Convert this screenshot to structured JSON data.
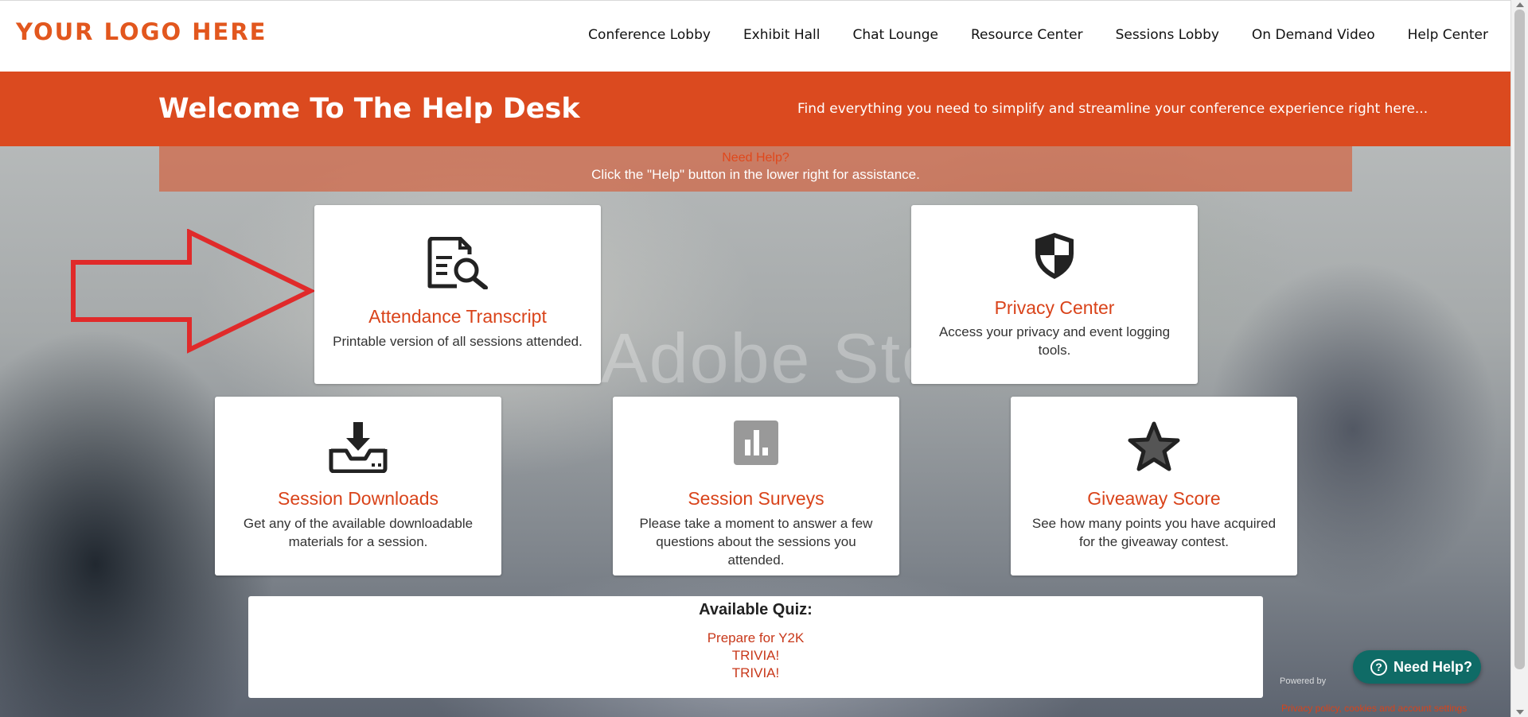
{
  "logo": {
    "text": "YOUR LOGO HERE"
  },
  "nav": {
    "items": [
      {
        "label": "Conference Lobby"
      },
      {
        "label": "Exhibit Hall"
      },
      {
        "label": "Chat Lounge"
      },
      {
        "label": "Resource Center"
      },
      {
        "label": "Sessions Lobby"
      },
      {
        "label": "On Demand Video"
      },
      {
        "label": "Help Center"
      }
    ]
  },
  "banner": {
    "title": "Welcome To The Help Desk",
    "subtitle": "Find everything you need to simplify and streamline your conference experience right here..."
  },
  "help_note": {
    "heading": "Need Help?",
    "text": "Click the \"Help\" button in the lower right for assistance."
  },
  "background": {
    "watermark": "Adobe Stock"
  },
  "cards": {
    "attendance": {
      "icon": "document-search-icon",
      "title": "Attendance Transcript",
      "description": "Printable version of all sessions attended."
    },
    "privacy": {
      "icon": "shield-icon",
      "title": "Privacy Center",
      "description": "Access your privacy and event logging tools."
    },
    "downloads": {
      "icon": "download-tray-icon",
      "title": "Session Downloads",
      "description": "Get any of the available downloadable materials for a session."
    },
    "surveys": {
      "icon": "bar-chart-icon",
      "title": "Session Surveys",
      "description": "Please take a moment to answer a few questions about the sessions you attended."
    },
    "giveaway": {
      "icon": "star-icon",
      "title": "Giveaway Score",
      "description": "See how many points you have acquired for the giveaway contest."
    }
  },
  "quiz": {
    "heading": "Available Quiz:",
    "items": [
      "Prepare for Y2K",
      "TRIVIA!",
      "TRIVIA!"
    ]
  },
  "help_button": {
    "label": "Need Help?"
  },
  "powered_by": "Powered by",
  "privacy_link": "Privacy policy, cookies and account settings",
  "colors": {
    "accent": "#db4a1f",
    "link": "#d9431a",
    "help_button": "#0f6b66",
    "arrow": "#e02a2a"
  }
}
